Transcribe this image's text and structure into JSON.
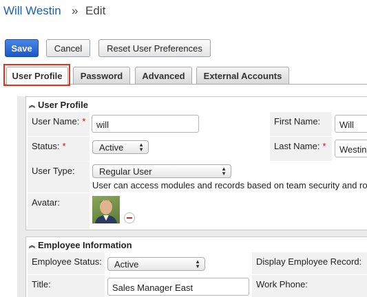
{
  "breadcrumb": {
    "user": "Will Westin",
    "sep": "»",
    "current": "Edit"
  },
  "toolbar": {
    "save_label": "Save",
    "cancel_label": "Cancel",
    "reset_label": "Reset User Preferences"
  },
  "tabs": [
    {
      "label": "User Profile",
      "active": true
    },
    {
      "label": "Password"
    },
    {
      "label": "Advanced"
    },
    {
      "label": "External Accounts"
    }
  ],
  "user_profile": {
    "header": "User Profile",
    "user_name_label": "User Name:",
    "user_name_value": "will",
    "first_name_label": "First Name:",
    "first_name_value": "Will",
    "status_label": "Status:",
    "status_value": "Active",
    "last_name_label": "Last Name:",
    "last_name_value": "Westin",
    "user_type_label": "User Type:",
    "user_type_value": "Regular User",
    "user_type_note": "User can access modules and records based on team security and ro",
    "avatar_label": "Avatar:",
    "required_mark": "*"
  },
  "employee_info": {
    "header": "Employee Information",
    "employee_status_label": "Employee Status:",
    "employee_status_value": "Active",
    "display_record_label": "Display Employee Record:",
    "title_label": "Title:",
    "title_value": "Sales Manager East",
    "work_phone_label": "Work Phone:"
  },
  "colors": {
    "highlight": "#e0311b",
    "link": "#1f5fa8",
    "primary": "#1a57c7"
  }
}
